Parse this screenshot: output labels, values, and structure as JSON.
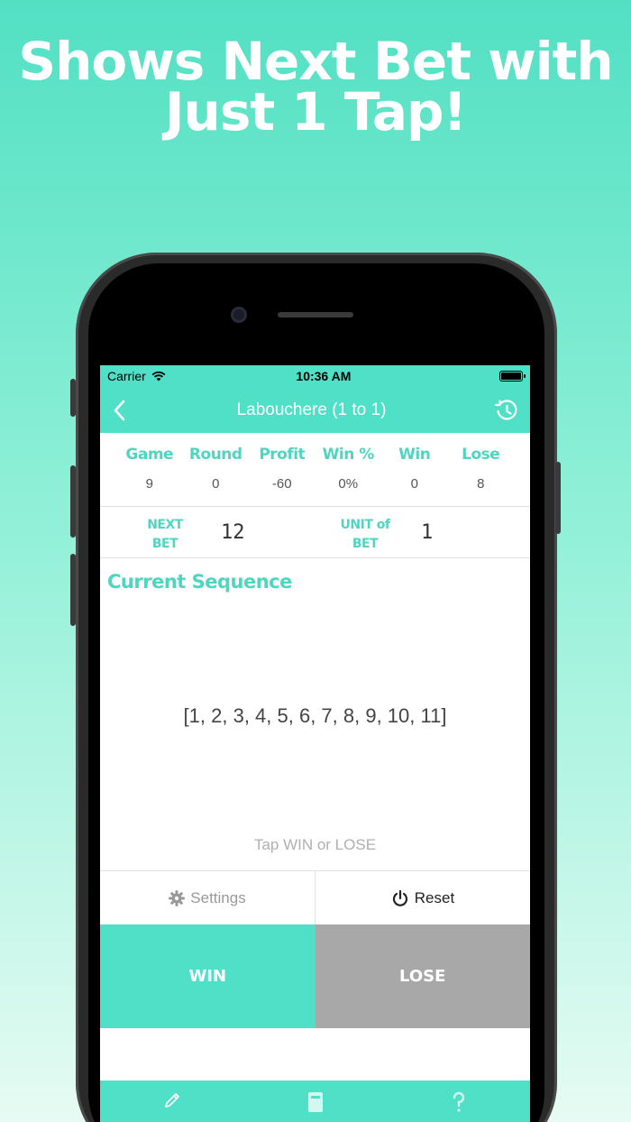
{
  "promo": {
    "line1": "Shows Next Bet with",
    "line2": "Just 1 Tap!"
  },
  "status": {
    "carrier": "Carrier",
    "time": "10:36 AM"
  },
  "nav": {
    "title": "Labouchere (1 to 1)",
    "back_icon": "chevron-left-icon",
    "history_icon": "history-icon"
  },
  "stats": {
    "headers": [
      "Game",
      "Round",
      "Profit",
      "Win %",
      "Win",
      "Lose"
    ],
    "values": [
      "9",
      "0",
      "-60",
      "0%",
      "0",
      "8"
    ]
  },
  "bet": {
    "next_label_1": "NEXT",
    "next_label_2": "BET",
    "next_value": "12",
    "unit_label_1": "UNIT of",
    "unit_label_2": "BET",
    "unit_value": "1"
  },
  "sequence": {
    "title": "Current Sequence",
    "values": "[1, 2, 3, 4, 5, 6, 7, 8, 9, 10, 11]",
    "hint": "Tap WIN or LOSE"
  },
  "actions": {
    "settings_label": "Settings",
    "reset_label": "Reset",
    "win_label": "WIN",
    "lose_label": "LOSE"
  },
  "colors": {
    "accent": "#4fe0c7",
    "lose": "#a8a8a8",
    "header_text": "#4fd6c0"
  }
}
